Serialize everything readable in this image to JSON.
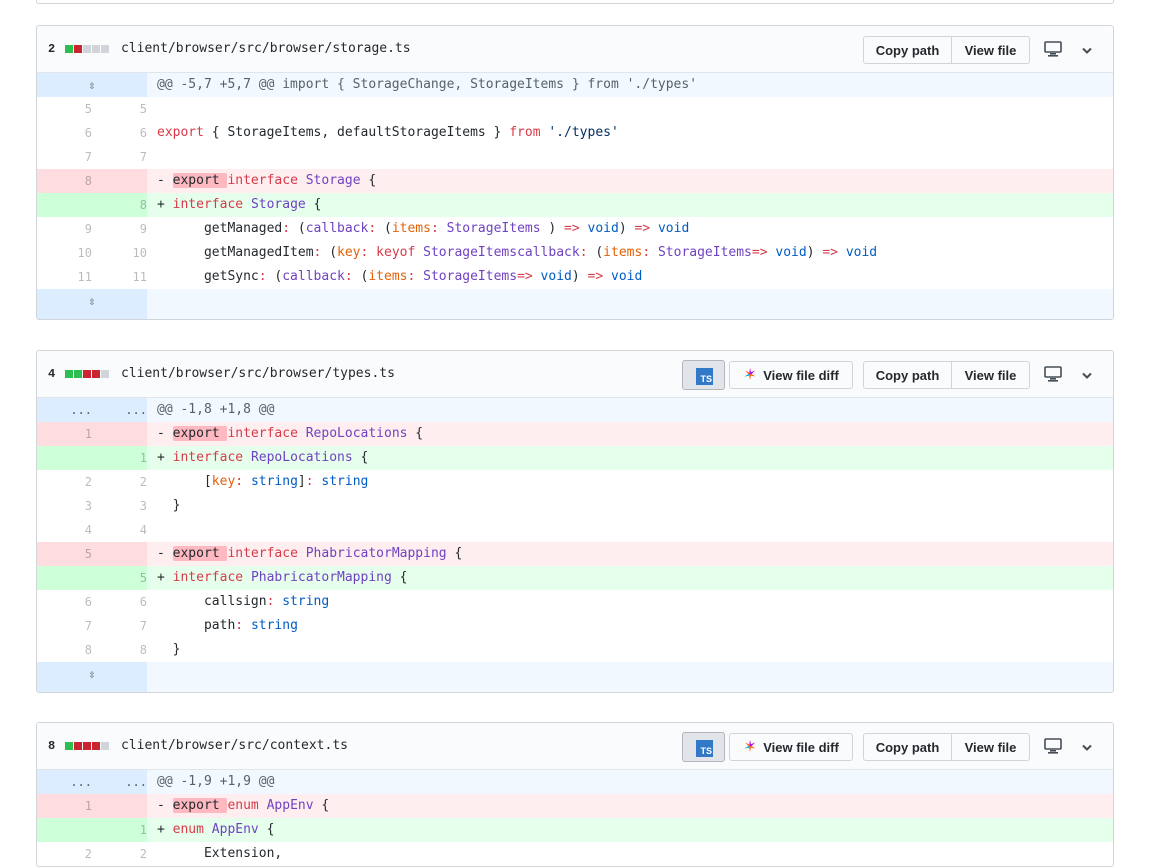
{
  "files": [
    {
      "count": "2",
      "blocks": [
        "add",
        "del",
        "neu",
        "neu",
        "neu"
      ],
      "path": "client/browser/src/browser/storage.ts",
      "has_ts": false,
      "buttons": {
        "copy_path": "Copy path",
        "view_file": "View file"
      },
      "lines": [
        {
          "t": "hunk",
          "a": "⇳",
          "b": "",
          "c": [
            [
              "",
              "@@ -5,7 +5,7 @@ import { StorageChange, StorageItems } from './types'"
            ]
          ]
        },
        {
          "t": "ctx",
          "a": "5",
          "b": "5",
          "c": [
            [
              "",
              ""
            ]
          ]
        },
        {
          "t": "ctx",
          "a": "6",
          "b": "6",
          "c": [
            [
              "kw",
              "export"
            ],
            [
              "",
              " { StorageItems, defaultStorageItems } "
            ],
            [
              "kw",
              "from"
            ],
            [
              "",
              " "
            ],
            [
              "st",
              "'./types'"
            ]
          ]
        },
        {
          "t": "ctx",
          "a": "7",
          "b": "7",
          "c": [
            [
              "",
              ""
            ]
          ]
        },
        {
          "t": "del",
          "a": "8",
          "b": "",
          "c": [
            [
              "",
              "- "
            ],
            [
              "xhl",
              "export "
            ],
            [
              "kw",
              "interface"
            ],
            [
              "",
              " "
            ],
            [
              "en",
              "Storage"
            ],
            [
              "",
              " {"
            ]
          ]
        },
        {
          "t": "add",
          "a": "",
          "b": "8",
          "c": [
            [
              "",
              "+ "
            ],
            [
              "kw",
              "interface"
            ],
            [
              "",
              " "
            ],
            [
              "en",
              "Storage"
            ],
            [
              "",
              " {"
            ]
          ]
        },
        {
          "t": "ctx",
          "a": "9",
          "b": "9",
          "c": [
            [
              "",
              "      getManaged"
            ],
            [
              "kw",
              ":"
            ],
            [
              "",
              " ("
            ],
            [
              "en",
              "callback"
            ],
            [
              "kw",
              ":"
            ],
            [
              "",
              " ("
            ],
            [
              "pm",
              "items"
            ],
            [
              "kw",
              ":"
            ],
            [
              "",
              " "
            ],
            [
              "en",
              "StorageItems"
            ],
            [
              "",
              " ) "
            ],
            [
              "kw",
              "=>"
            ],
            [
              "",
              " "
            ],
            [
              "cn",
              "void"
            ],
            [
              "",
              ") "
            ],
            [
              "kw",
              "=>"
            ],
            [
              "",
              " "
            ],
            [
              "cn",
              "void"
            ]
          ]
        },
        {
          "t": "ctx",
          "a": "10",
          "b": "10",
          "c": [
            [
              "",
              "      getManagedItem"
            ],
            [
              "kw",
              ":"
            ],
            [
              "",
              " ("
            ],
            [
              "pm",
              "key"
            ],
            [
              "kw",
              ":"
            ],
            [
              "",
              " "
            ],
            [
              "kw",
              "keyof"
            ],
            [
              "",
              " "
            ],
            [
              "en",
              "StorageItems"
            ],
            [
              ", "
            ],
            [
              "en",
              "callback"
            ],
            [
              "kw",
              ":"
            ],
            [
              "",
              " ("
            ],
            [
              "pm",
              "items"
            ],
            [
              "kw",
              ":"
            ],
            [
              "",
              " "
            ],
            [
              "en",
              "StorageItems"
            ],
            [
              ") "
            ],
            [
              "kw",
              "=>"
            ],
            [
              "",
              " "
            ],
            [
              "cn",
              "void"
            ],
            [
              "",
              ") "
            ],
            [
              "kw",
              "=>"
            ],
            [
              "",
              " "
            ],
            [
              "cn",
              "void"
            ]
          ]
        },
        {
          "t": "ctx",
          "a": "11",
          "b": "11",
          "c": [
            [
              "",
              "      getSync"
            ],
            [
              "kw",
              ":"
            ],
            [
              "",
              " ("
            ],
            [
              "en",
              "callback"
            ],
            [
              "kw",
              ":"
            ],
            [
              "",
              " ("
            ],
            [
              "pm",
              "items"
            ],
            [
              "kw",
              ":"
            ],
            [
              "",
              " "
            ],
            [
              "en",
              "StorageItems"
            ],
            [
              ") "
            ],
            [
              "kw",
              "=>"
            ],
            [
              "",
              " "
            ],
            [
              "cn",
              "void"
            ],
            [
              "",
              ") "
            ],
            [
              "kw",
              "=>"
            ],
            [
              "",
              " "
            ],
            [
              "cn",
              "void"
            ]
          ]
        },
        {
          "t": "exp",
          "a": "⇳",
          "b": "",
          "c": [
            [
              "",
              ""
            ]
          ]
        }
      ]
    },
    {
      "count": "4",
      "blocks": [
        "add",
        "add",
        "del",
        "del",
        "neu"
      ],
      "path": "client/browser/src/browser/types.ts",
      "has_ts": true,
      "ts_label": "TS",
      "view_file_diff": "View file diff",
      "buttons": {
        "copy_path": "Copy path",
        "view_file": "View file"
      },
      "lines": [
        {
          "t": "hunk",
          "a": "...",
          "b": "...",
          "c": [
            [
              "",
              "@@ -1,8 +1,8 @@"
            ]
          ]
        },
        {
          "t": "del",
          "a": "1",
          "b": "",
          "c": [
            [
              "",
              "- "
            ],
            [
              "xhl",
              "export "
            ],
            [
              "kw",
              "interface"
            ],
            [
              "",
              " "
            ],
            [
              "en",
              "RepoLocations"
            ],
            [
              "",
              " {"
            ]
          ]
        },
        {
          "t": "add",
          "a": "",
          "b": "1",
          "c": [
            [
              "",
              "+ "
            ],
            [
              "kw",
              "interface"
            ],
            [
              "",
              " "
            ],
            [
              "en",
              "RepoLocations"
            ],
            [
              "",
              " {"
            ]
          ]
        },
        {
          "t": "ctx",
          "a": "2",
          "b": "2",
          "c": [
            [
              "",
              "      ["
            ],
            [
              "pm",
              "key"
            ],
            [
              "kw",
              ":"
            ],
            [
              "",
              " "
            ],
            [
              "cn",
              "string"
            ],
            [
              "",
              "]"
            ],
            [
              "kw",
              ":"
            ],
            [
              "",
              " "
            ],
            [
              "cn",
              "string"
            ]
          ]
        },
        {
          "t": "ctx",
          "a": "3",
          "b": "3",
          "c": [
            [
              "",
              "  }"
            ]
          ]
        },
        {
          "t": "ctx",
          "a": "4",
          "b": "4",
          "c": [
            [
              "",
              ""
            ]
          ]
        },
        {
          "t": "del",
          "a": "5",
          "b": "",
          "c": [
            [
              "",
              "- "
            ],
            [
              "xhl",
              "export "
            ],
            [
              "kw",
              "interface"
            ],
            [
              "",
              " "
            ],
            [
              "en",
              "PhabricatorMapping"
            ],
            [
              "",
              " {"
            ]
          ]
        },
        {
          "t": "add",
          "a": "",
          "b": "5",
          "c": [
            [
              "",
              "+ "
            ],
            [
              "kw",
              "interface"
            ],
            [
              "",
              " "
            ],
            [
              "en",
              "PhabricatorMapping"
            ],
            [
              "",
              " {"
            ]
          ]
        },
        {
          "t": "ctx",
          "a": "6",
          "b": "6",
          "c": [
            [
              "",
              "      callsign"
            ],
            [
              "kw",
              ":"
            ],
            [
              "",
              " "
            ],
            [
              "cn",
              "string"
            ]
          ]
        },
        {
          "t": "ctx",
          "a": "7",
          "b": "7",
          "c": [
            [
              "",
              "      path"
            ],
            [
              "kw",
              ":"
            ],
            [
              "",
              " "
            ],
            [
              "cn",
              "string"
            ]
          ]
        },
        {
          "t": "ctx",
          "a": "8",
          "b": "8",
          "c": [
            [
              "",
              "  }"
            ]
          ]
        },
        {
          "t": "exp",
          "a": "⇳",
          "b": "",
          "c": [
            [
              "",
              ""
            ]
          ]
        }
      ]
    },
    {
      "count": "8",
      "blocks": [
        "add",
        "del",
        "del",
        "del",
        "neu"
      ],
      "path": "client/browser/src/context.ts",
      "has_ts": true,
      "ts_label": "TS",
      "view_file_diff": "View file diff",
      "buttons": {
        "copy_path": "Copy path",
        "view_file": "View file"
      },
      "lines": [
        {
          "t": "hunk",
          "a": "...",
          "b": "...",
          "c": [
            [
              "",
              "@@ -1,9 +1,9 @@"
            ]
          ]
        },
        {
          "t": "del",
          "a": "1",
          "b": "",
          "c": [
            [
              "",
              "- "
            ],
            [
              "xhl",
              "export "
            ],
            [
              "kw",
              "enum"
            ],
            [
              "",
              " "
            ],
            [
              "en",
              "AppEnv"
            ],
            [
              "",
              " {"
            ]
          ]
        },
        {
          "t": "add",
          "a": "",
          "b": "1",
          "c": [
            [
              "",
              "+ "
            ],
            [
              "kw",
              "enum"
            ],
            [
              "",
              " "
            ],
            [
              "en",
              "AppEnv"
            ],
            [
              "",
              " {"
            ]
          ]
        },
        {
          "t": "ctx",
          "a": "2",
          "b": "2",
          "c": [
            [
              "",
              "      Extension,"
            ]
          ]
        }
      ]
    }
  ]
}
